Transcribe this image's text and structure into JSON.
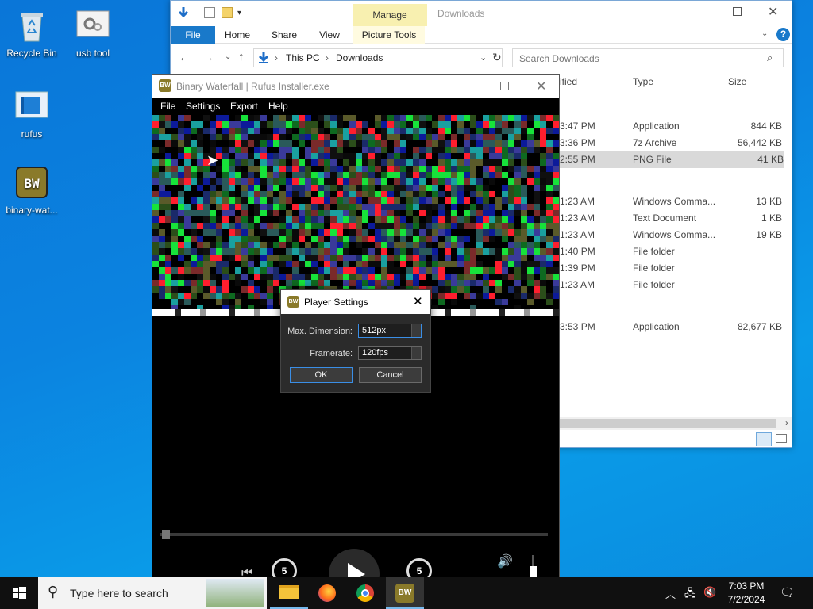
{
  "desktop": {
    "icons": [
      {
        "label": "Recycle Bin"
      },
      {
        "label": "usb tool"
      },
      {
        "label": "rufus"
      },
      {
        "label": "binary-wat..."
      }
    ]
  },
  "explorer": {
    "manage_tab": "Manage",
    "window_title": "Downloads",
    "tabs": [
      "File",
      "Home",
      "Share",
      "View",
      "Picture Tools"
    ],
    "breadcrumb": [
      "This PC",
      "Downloads"
    ],
    "search_placeholder": "Search Downloads",
    "columns": {
      "modified": "ified",
      "type": "Type",
      "size": "Size"
    },
    "rows": [
      {
        "time": "3:47 PM",
        "type": "Application",
        "size": "844 KB"
      },
      {
        "time": "3:36 PM",
        "type": "7z Archive",
        "size": "56,442 KB"
      },
      {
        "time": "2:55 PM",
        "type": "PNG File",
        "size": "41 KB",
        "selected": true
      },
      {
        "time": "1:23 AM",
        "type": "Windows Comma...",
        "size": "13 KB"
      },
      {
        "time": "1:23 AM",
        "type": "Text Document",
        "size": "1 KB"
      },
      {
        "time": "1:23 AM",
        "type": "Windows Comma...",
        "size": "19 KB"
      },
      {
        "time": "1:40 PM",
        "type": "File folder",
        "size": ""
      },
      {
        "time": "1:39 PM",
        "type": "File folder",
        "size": ""
      },
      {
        "time": "1:23 AM",
        "type": "File folder",
        "size": ""
      },
      {
        "time": "3:53 PM",
        "type": "Application",
        "size": "82,677 KB"
      }
    ]
  },
  "binary_waterfall": {
    "title": "Binary Waterfall | Rufus Installer.exe",
    "menu": [
      "File",
      "Settings",
      "Export",
      "Help"
    ],
    "controls": {
      "rewind_label": "5",
      "forward_label": "5"
    }
  },
  "dialog": {
    "title": "Player Settings",
    "max_dimension_label": "Max. Dimension:",
    "max_dimension_value": "512px",
    "framerate_label": "Framerate:",
    "framerate_value": "120fps",
    "ok_label": "OK",
    "cancel_label": "Cancel"
  },
  "taskbar": {
    "search_placeholder": "Type here to search",
    "time": "7:03 PM",
    "date": "7/2/2024"
  },
  "colors": {
    "accent": "#0078d7",
    "selected_row": "#d9d9d9"
  }
}
